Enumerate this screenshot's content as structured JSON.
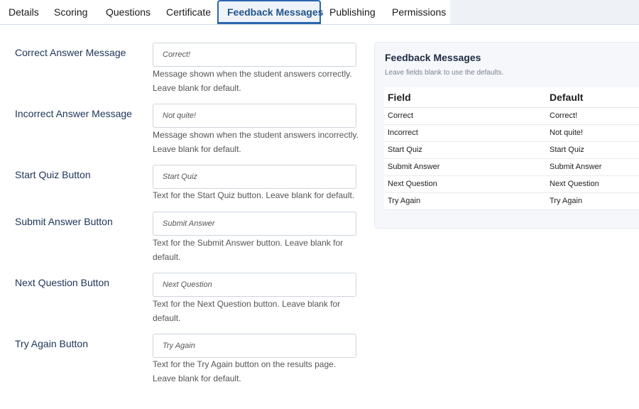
{
  "tabs": [
    {
      "label": "Details"
    },
    {
      "label": "Scoring"
    },
    {
      "label": "Questions"
    },
    {
      "label": "Certificate"
    },
    {
      "label": "Feedback Messages",
      "active": true
    },
    {
      "label": "Publishing"
    },
    {
      "label": "Permissions"
    }
  ],
  "fields": [
    {
      "label": "Correct Answer Message",
      "placeholder": "Correct!",
      "help": "Message shown when the student answers correctly. Leave blank for default."
    },
    {
      "label": "Incorrect Answer Message",
      "placeholder": "Not quite!",
      "help": "Message shown when the student answers incorrectly. Leave blank for default."
    },
    {
      "label": "Start Quiz Button",
      "placeholder": "Start Quiz",
      "help": "Text for the Start Quiz button. Leave blank for default."
    },
    {
      "label": "Submit Answer Button",
      "placeholder": "Submit Answer",
      "help": "Text for the Submit Answer button. Leave blank for default."
    },
    {
      "label": "Next Question Button",
      "placeholder": "Next Question",
      "help": "Text for the Next Question button. Leave blank for default."
    },
    {
      "label": "Try Again Button",
      "placeholder": "Try Again",
      "help": "Text for the Try Again button on the results page. Leave blank for default."
    }
  ],
  "panel": {
    "title": "Feedback Messages",
    "subtitle": "Leave fields blank to use the defaults.",
    "table": {
      "headers": [
        "Field",
        "Default"
      ],
      "rows": [
        [
          "Correct",
          "Correct!"
        ],
        [
          "Incorrect",
          "Not quite!"
        ],
        [
          "Start Quiz",
          "Start Quiz"
        ],
        [
          "Submit Answer",
          "Submit Answer"
        ],
        [
          "Next Question",
          "Next Question"
        ],
        [
          "Try Again",
          "Try Again"
        ]
      ]
    }
  },
  "colors": {
    "active_tab_border": "#2a66ad",
    "active_tab_text": "#1f5389",
    "label_text": "#1d3458",
    "panel_bg": "#f5f7fa"
  }
}
